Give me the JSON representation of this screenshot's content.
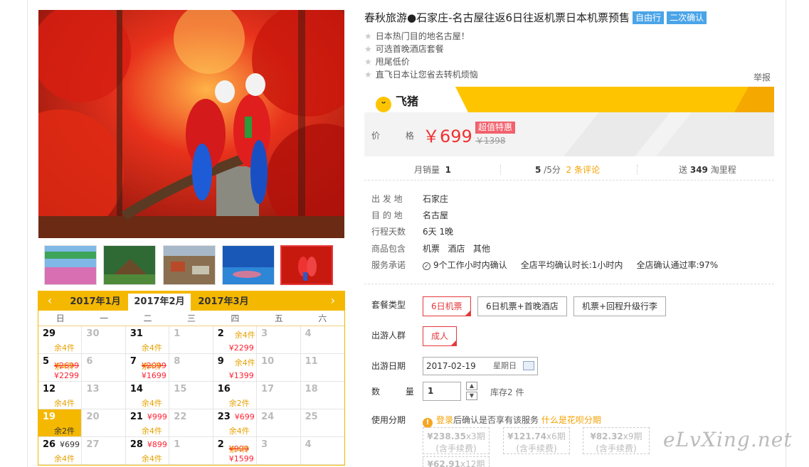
{
  "product": {
    "title": "春秋旅游●石家庄-名古屋往返6日往返机票日本机票预售",
    "tags": [
      "自由行",
      "二次确认"
    ],
    "features": [
      "日本热门目的地名古屋！",
      "可选首晚酒店套餐",
      "甩尾低价",
      "直飞日本让您省去转机烦恼"
    ],
    "report": "举报"
  },
  "brand": {
    "name": "飞猪",
    "logo_icon": "fliggy-face-icon",
    "color": "#ffc400"
  },
  "price": {
    "label": "价 格",
    "current": "￥699",
    "badge": "超值特惠",
    "original": "￥1398"
  },
  "stats": {
    "monthly_label": "月销量",
    "monthly_value": "1",
    "rating_value": "5",
    "rating_suffix": "/5分",
    "reviews": "2 条评论",
    "points_prefix": "送",
    "points_value": "349",
    "points_suffix": "淘里程"
  },
  "attributes": [
    {
      "key": "出 发 地",
      "value": "石家庄"
    },
    {
      "key": "目 的 地",
      "value": "名古屋"
    },
    {
      "key": "行程天数",
      "value": "6天 1晚"
    },
    {
      "key": "商品包含",
      "value": "机票   酒店   其他"
    },
    {
      "key": "服务承诺",
      "value": "9个工作小时内确认     全店平均确认时长:1小时内     全店确认通过率:97%"
    }
  ],
  "options": {
    "package_label": "套餐类型",
    "packages": [
      "6日机票",
      "6日机票+首晚酒店",
      "机票+回程升级行李"
    ],
    "crowd_label": "出游人群",
    "crowds": [
      "成人"
    ],
    "date_label": "出游日期",
    "date_value": "2017-02-19",
    "date_weekday": "星期日",
    "qty_label": "数 量",
    "qty_value": "1",
    "stock": "库存2 件",
    "installment_label": "使用分期",
    "installment_link1": "登录",
    "installment_text": "后确认是否享有该服务",
    "installment_link2": "什么是花呗分期",
    "installments": [
      {
        "price": "¥238.35",
        "period": "x3期",
        "note": "(含手续费)"
      },
      {
        "price": "¥121.74",
        "period": "x6期",
        "note": "(含手续费)"
      },
      {
        "price": "¥82.32",
        "period": "x9期",
        "note": "(含手续费)"
      },
      {
        "price": "¥62.91",
        "period": "x12期",
        "note": ""
      }
    ]
  },
  "calendar": {
    "months": [
      "2017年1月",
      "2017年2月",
      "2017年3月"
    ],
    "selected_month": "2017年2月",
    "weekdays": [
      "日",
      "一",
      "二",
      "三",
      "四",
      "五",
      "六"
    ],
    "cells": [
      {
        "d": "29",
        "stock": "余4件",
        "price": "",
        "price2": ""
      },
      {
        "d": "30",
        "off": true
      },
      {
        "d": "31",
        "stock": "余4件"
      },
      {
        "d": "1",
        "off": true
      },
      {
        "d": "2",
        "price": "余4件",
        "price2": "¥2299"
      },
      {
        "d": "3",
        "off": true
      },
      {
        "d": "4",
        "off": true
      },
      {
        "d": "5",
        "price": "¥2699",
        "stock": "余4件",
        "price2": "¥2299"
      },
      {
        "d": "6",
        "off": true
      },
      {
        "d": "7",
        "price": "¥2099",
        "stock": "余4件",
        "price2": "¥1699"
      },
      {
        "d": "8",
        "off": true
      },
      {
        "d": "9",
        "price": "余4件",
        "price2": "¥1399"
      },
      {
        "d": "10",
        "off": true
      },
      {
        "d": "11",
        "off": true
      },
      {
        "d": "12",
        "stock": "余4件"
      },
      {
        "d": "13",
        "off": true
      },
      {
        "d": "14",
        "stock": "余4件"
      },
      {
        "d": "15",
        "off": true
      },
      {
        "d": "16",
        "stock": "余2件"
      },
      {
        "d": "17",
        "off": true
      },
      {
        "d": "18",
        "off": true
      },
      {
        "d": "19",
        "stock": "余2件",
        "today": true
      },
      {
        "d": "20",
        "off": true
      },
      {
        "d": "21",
        "price": "¥999",
        "stock": "余4件"
      },
      {
        "d": "22",
        "off": true
      },
      {
        "d": "23",
        "price": "¥699",
        "stock": "余4件"
      },
      {
        "d": "24",
        "off": true
      },
      {
        "d": "25",
        "off": true
      },
      {
        "d": "26",
        "price": "¥699",
        "stock": "余4件",
        "muted": true
      },
      {
        "d": "27",
        "off": true
      },
      {
        "d": "28",
        "price": "¥899",
        "stock": "余4件"
      },
      {
        "d": "1",
        "off": true
      },
      {
        "d": "2",
        "price": "¥999",
        "stock": "余4件",
        "price2": "¥1599"
      },
      {
        "d": "3",
        "off": true
      },
      {
        "d": "4",
        "off": true
      }
    ]
  },
  "watermark": "eLvXing.net"
}
